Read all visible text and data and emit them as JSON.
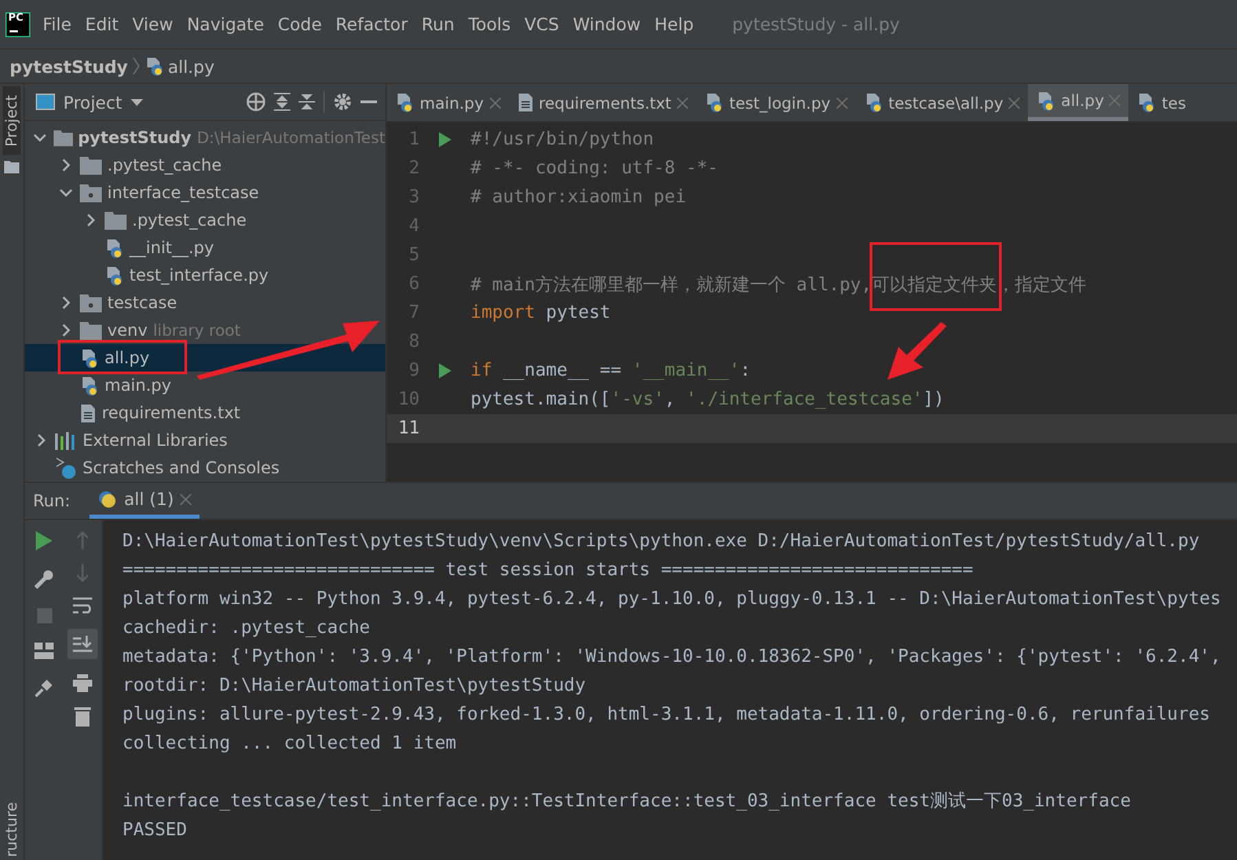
{
  "menu_bar": {
    "logo": "PC",
    "items": [
      "File",
      "Edit",
      "View",
      "Navigate",
      "Code",
      "Refactor",
      "Run",
      "Tools",
      "VCS",
      "Window",
      "Help"
    ],
    "title": "pytestStudy - all.py"
  },
  "breadcrumb": [
    "pytestStudy",
    "all.py"
  ],
  "side_strip": {
    "top": "Project",
    "bottom": "ructure"
  },
  "project_panel": {
    "title": "Project",
    "tree": [
      {
        "label": "pytestStudy",
        "hint": "D:\\HaierAutomationTest",
        "kind": "root",
        "expanded": true,
        "selected": false,
        "children": [
          {
            "label": ".pytest_cache",
            "kind": "folder",
            "expanded": false,
            "selected": false
          },
          {
            "label": "interface_testcase",
            "kind": "package",
            "expanded": true,
            "selected": false,
            "children": [
              {
                "label": ".pytest_cache",
                "kind": "folder",
                "expanded": false,
                "selected": false
              },
              {
                "label": "__init__.py",
                "kind": "py",
                "selected": false
              },
              {
                "label": "test_interface.py",
                "kind": "py",
                "selected": false
              }
            ]
          },
          {
            "label": "testcase",
            "kind": "package",
            "expanded": false,
            "selected": false
          },
          {
            "label": "venv",
            "hint": "library root",
            "kind": "folder",
            "expanded": false,
            "selected": false
          },
          {
            "label": "all.py",
            "kind": "py",
            "selected": true
          },
          {
            "label": "main.py",
            "kind": "py",
            "selected": false
          },
          {
            "label": "requirements.txt",
            "kind": "txt",
            "selected": false
          }
        ]
      },
      {
        "label": "External Libraries",
        "kind": "library",
        "expanded": false,
        "selected": false
      },
      {
        "label": "Scratches and Consoles",
        "kind": "scratch",
        "selected": false
      }
    ]
  },
  "editor": {
    "tabs": [
      {
        "label": "main.py",
        "kind": "py",
        "selected": false
      },
      {
        "label": "requirements.txt",
        "kind": "txt",
        "selected": false
      },
      {
        "label": "test_login.py",
        "kind": "py",
        "selected": false
      },
      {
        "label": "testcase\\all.py",
        "kind": "py",
        "selected": false
      },
      {
        "label": "all.py",
        "kind": "py",
        "selected": true
      },
      {
        "label": "tes",
        "kind": "py",
        "selected": false
      }
    ],
    "lines": [
      {
        "number": "1",
        "run": true,
        "tokens": [
          {
            "kind": "comment",
            "text": "#!/usr/bin/python"
          }
        ]
      },
      {
        "number": "2",
        "run": false,
        "tokens": [
          {
            "kind": "comment",
            "text": "# -*- coding: utf-8 -*-"
          }
        ]
      },
      {
        "number": "3",
        "run": false,
        "tokens": [
          {
            "kind": "comment",
            "text": "# author:xiaomin pei"
          }
        ]
      },
      {
        "number": "4",
        "run": false
      },
      {
        "number": "5",
        "run": false
      },
      {
        "number": "6",
        "run": false,
        "tokens": [
          {
            "kind": "comment",
            "text": "# main方法在哪里都一样，就新建一个 all.py,可以指定文件夹，指定文件"
          }
        ]
      },
      {
        "number": "7",
        "run": false,
        "tokens": [
          {
            "kind": "keyword",
            "text": "import"
          },
          {
            "kind": "plain",
            "text": " pytest"
          }
        ]
      },
      {
        "number": "8",
        "run": false
      },
      {
        "number": "9",
        "run": true,
        "tokens": [
          {
            "kind": "keyword",
            "text": "if"
          },
          {
            "kind": "plain",
            "text": " __name__ == "
          },
          {
            "kind": "string",
            "text": "'__main__'"
          },
          {
            "kind": "plain",
            "text": ":"
          }
        ]
      },
      {
        "number": "10",
        "run": false,
        "tokens": [
          {
            "kind": "plain",
            "text": "    pytest.main(["
          },
          {
            "kind": "string",
            "text": "'-vs'"
          },
          {
            "kind": "plain",
            "text": ", "
          },
          {
            "kind": "string",
            "text": "'./interface_testcase'"
          },
          {
            "kind": "plain",
            "text": "])"
          }
        ]
      },
      {
        "number": "11",
        "run": false,
        "current": true
      }
    ]
  },
  "run_panel": {
    "label": "Run:",
    "tab": "all (1)",
    "output_blocks": [
      [
        {
          "text": "D:\\HaierAutomationTest\\pytestStudy\\venv\\Scripts\\python.exe D:/HaierAutomationTest/pytestStudy/all.py"
        },
        {
          "text": "============================= test session starts ============================="
        },
        {
          "text": "platform win32 -- Python 3.9.4, pytest-6.2.4, py-1.10.0, pluggy-0.13.1 -- D:\\HaierAutomationTest\\pytes"
        },
        {
          "text": "cachedir: .pytest_cache"
        },
        {
          "text": "metadata: {'Python': '3.9.4', 'Platform': 'Windows-10-10.0.18362-SP0', 'Packages': {'pytest': '6.2.4',"
        },
        {
          "text": "rootdir: D:\\HaierAutomationTest\\pytestStudy"
        },
        {
          "text": "plugins: allure-pytest-2.9.43, forked-1.3.0, html-3.1.1, metadata-1.11.0, ordering-0.6, rerunfailures"
        },
        {
          "text": "collecting ... collected 1 item"
        }
      ],
      [
        {
          "text": "interface_testcase/test_interface.py::TestInterface::test_03_interface test测试一下03_interface"
        },
        {
          "text": "PASSED"
        }
      ]
    ]
  }
}
